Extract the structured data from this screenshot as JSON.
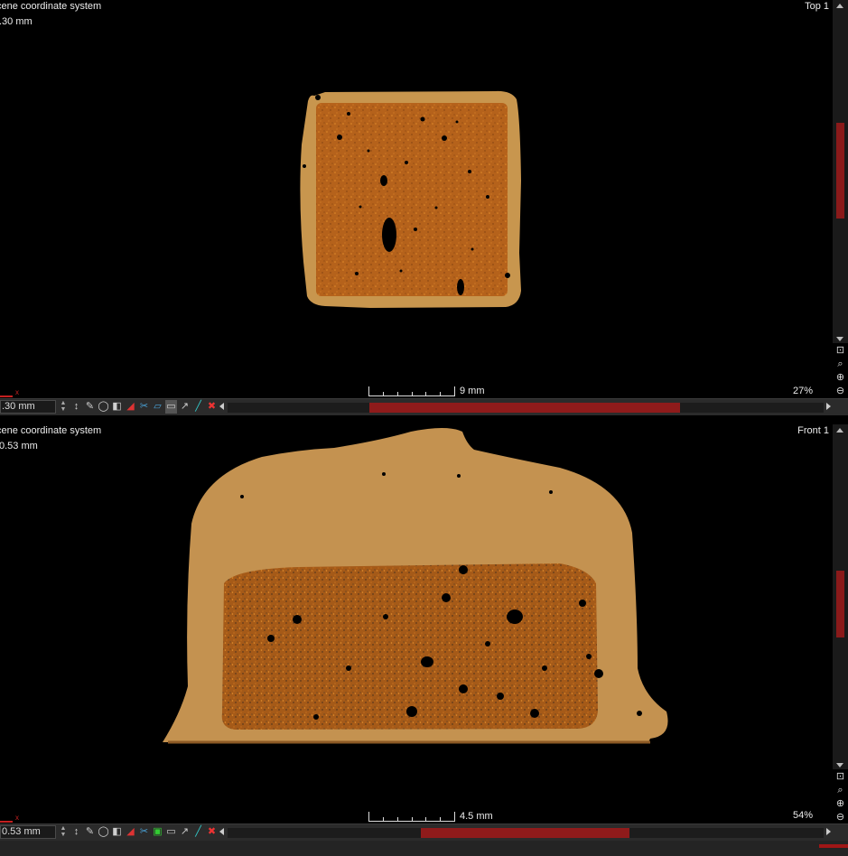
{
  "colors": {
    "accent": "#8f1b1b",
    "specimen_shell": "#c8964e",
    "specimen_core": "#b4641c",
    "background": "#000000"
  },
  "panes": {
    "top": {
      "coord_system": "cene coordinate system",
      "position": ".30 mm",
      "view_name": "Top 1",
      "scale_label": "9 mm",
      "zoom": "27%",
      "slice_value": ".30 mm",
      "hscroll_fraction": 0.67
    },
    "front": {
      "coord_system": "cene coordinate system",
      "position": "0.53 mm",
      "view_name": "Front 1",
      "scale_label": "4.5 mm",
      "zoom": "54%",
      "slice_value": "0.53 mm",
      "hscroll_fraction": 0.5
    }
  },
  "axis_label": "x",
  "icons": {
    "zoom_fit": "zoom-fit-icon",
    "zoom_search": "magnifier-icon",
    "zoom_in": "zoom-in-icon",
    "zoom_out": "zoom-out-icon"
  },
  "toolbar_icons": [
    "pick-icon",
    "pipette-icon",
    "sphere-icon",
    "contrast-icon",
    "ruler-angle-icon",
    "cut-icon",
    "box-icon",
    "measure-icon",
    "curve-icon",
    "line-icon",
    "reset-icon"
  ]
}
